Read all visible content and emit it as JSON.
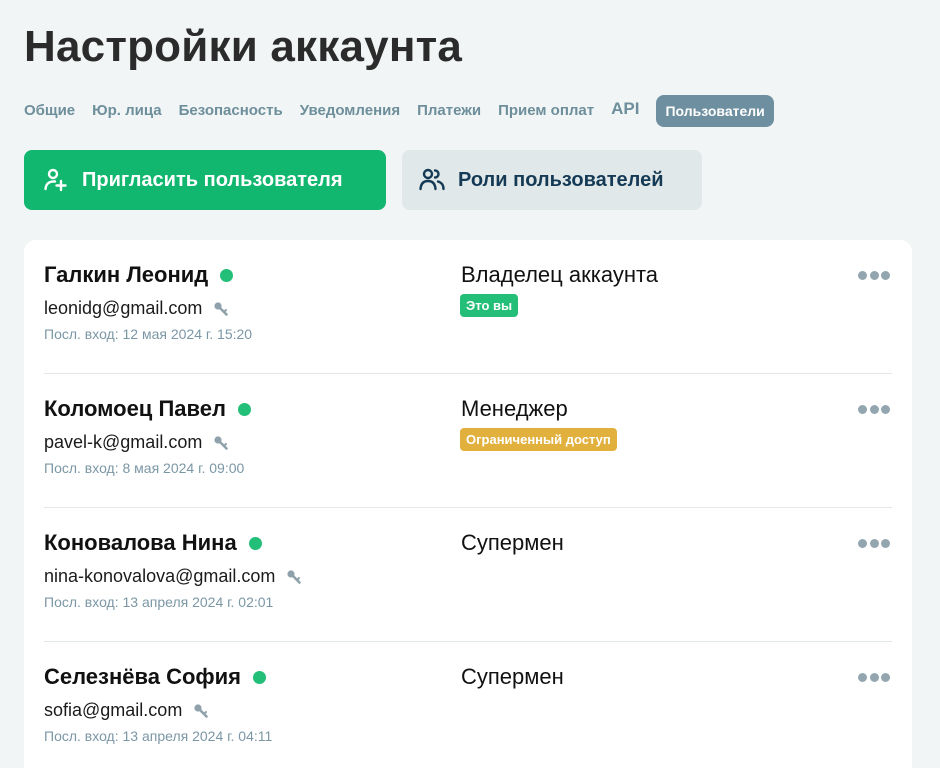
{
  "header": {
    "title": "Настройки аккаунта"
  },
  "tabs": [
    {
      "label": "Общие"
    },
    {
      "label": "Юр. лица"
    },
    {
      "label": "Безопасность"
    },
    {
      "label": "Уведомления"
    },
    {
      "label": "Платежи"
    },
    {
      "label": "Прием оплат"
    },
    {
      "label": "API"
    },
    {
      "label": "Пользователи",
      "active": true
    }
  ],
  "actions": {
    "invite_label": "Пригласить пользователя",
    "roles_label": "Роли пользователей"
  },
  "users": [
    {
      "name": "Галкин Леонид",
      "email": "leonidg@gmail.com",
      "last_login": "Посл. вход: 12 мая 2024 г. 15:20",
      "role": "Владелец аккаунта",
      "badge": "Это вы",
      "badge_color": "#23bf78"
    },
    {
      "name": "Коломоец Павел",
      "email": "pavel-k@gmail.com",
      "last_login": "Посл. вход: 8 мая 2024 г. 09:00",
      "role": "Менеджер",
      "badge": "Ограниченный доступ",
      "badge_color": "#e2b13d"
    },
    {
      "name": "Коновалова Нина",
      "email": "nina-konovalova@gmail.com",
      "last_login": "Посл. вход: 13 апреля 2024 г. 02:01",
      "role": "Супермен",
      "badge": "",
      "badge_color": ""
    },
    {
      "name": "Селезнёва София",
      "email": "sofia@gmail.com",
      "last_login": "Посл. вход: 13 апреля 2024 г. 04:11",
      "role": "Супермен",
      "badge": "",
      "badge_color": ""
    }
  ],
  "icons": {
    "invite": "user-plus-icon",
    "roles": "users-icon",
    "online": "online-status-dot",
    "key": "key-icon",
    "more": "more-horizontal-icon"
  },
  "colors": {
    "accent": "#12b76f",
    "tab_active_bg": "#6d8fa0",
    "online": "#23bf78"
  }
}
